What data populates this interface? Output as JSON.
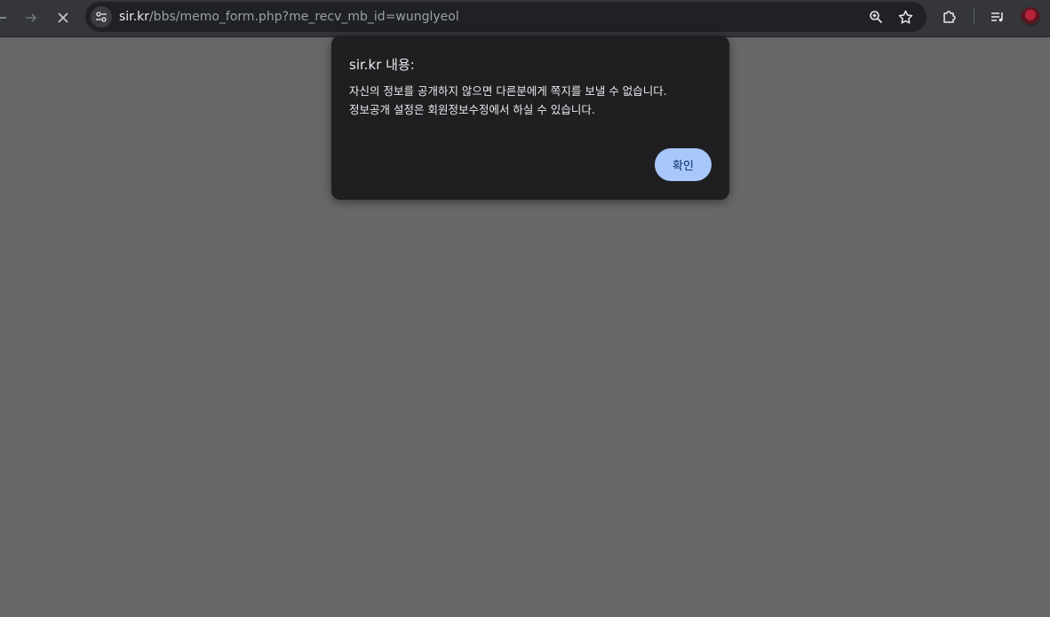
{
  "browser": {
    "url_host": "sir.kr",
    "url_path": "/bbs/memo_form.php?me_recv_mb_id=wunglyeol",
    "icons": {
      "back": "arrow-left-icon",
      "forward": "arrow-right-icon",
      "stop": "close-icon",
      "site_settings": "tune-icon",
      "zoom": "zoom-icon",
      "bookmark": "star-icon",
      "extensions": "puzzle-icon",
      "media": "media-queue-icon",
      "profile": "avatar"
    }
  },
  "dialog": {
    "title": "sir.kr 내용:",
    "message_lines": [
      "자신의 정보를 공개하지 않으면 다른분에게 쪽지를 보낼 수 없습니다.",
      "정보공개 설정은 회원정보수정에서 하실 수 있습니다."
    ],
    "ok_label": "확인"
  },
  "colors": {
    "page_bg": "#676767",
    "toolbar_bg": "#35363a",
    "dialog_bg": "#1f1f21",
    "button_bg": "#a8c7fa"
  }
}
